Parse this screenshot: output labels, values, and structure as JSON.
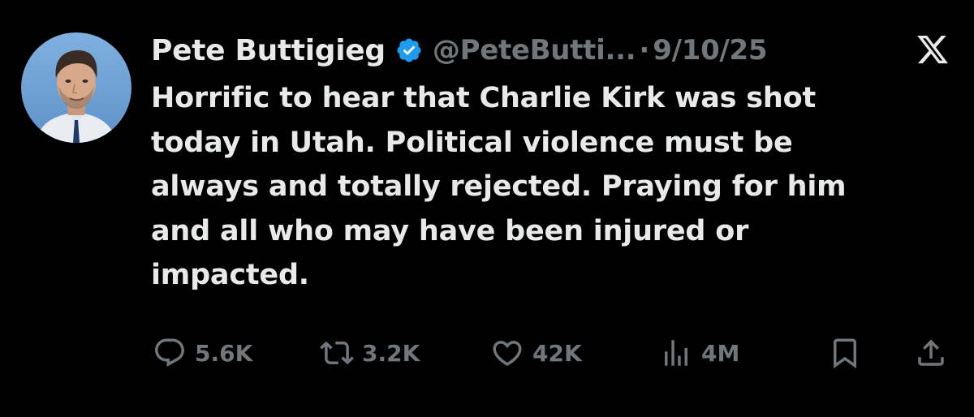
{
  "tweet": {
    "author": {
      "display_name": "Pete Buttigieg",
      "handle": "@PeteButti...",
      "verified": true,
      "avatar": "avatar-photo"
    },
    "separator": "·",
    "date": "9/10/25",
    "text_lines": [
      "Horrific to hear that Charlie Kirk was shot",
      "today in Utah. Political violence must be",
      "always and totally rejected. Praying for him",
      "and all who may have been injured or",
      "impacted."
    ],
    "stats": {
      "replies": "5.6K",
      "reposts": "3.2K",
      "likes": "42K",
      "views": "4M"
    }
  },
  "icons": {
    "verified": "verified-badge-icon",
    "platform": "x-logo-icon",
    "reply": "reply-icon",
    "repost": "repost-icon",
    "like": "heart-icon",
    "views": "views-icon",
    "bookmark": "bookmark-icon",
    "share": "share-icon"
  },
  "colors": {
    "background": "#000000",
    "text": "#e7e9ea",
    "secondary": "#71767b",
    "verified_blue": "#1d9bf0"
  }
}
